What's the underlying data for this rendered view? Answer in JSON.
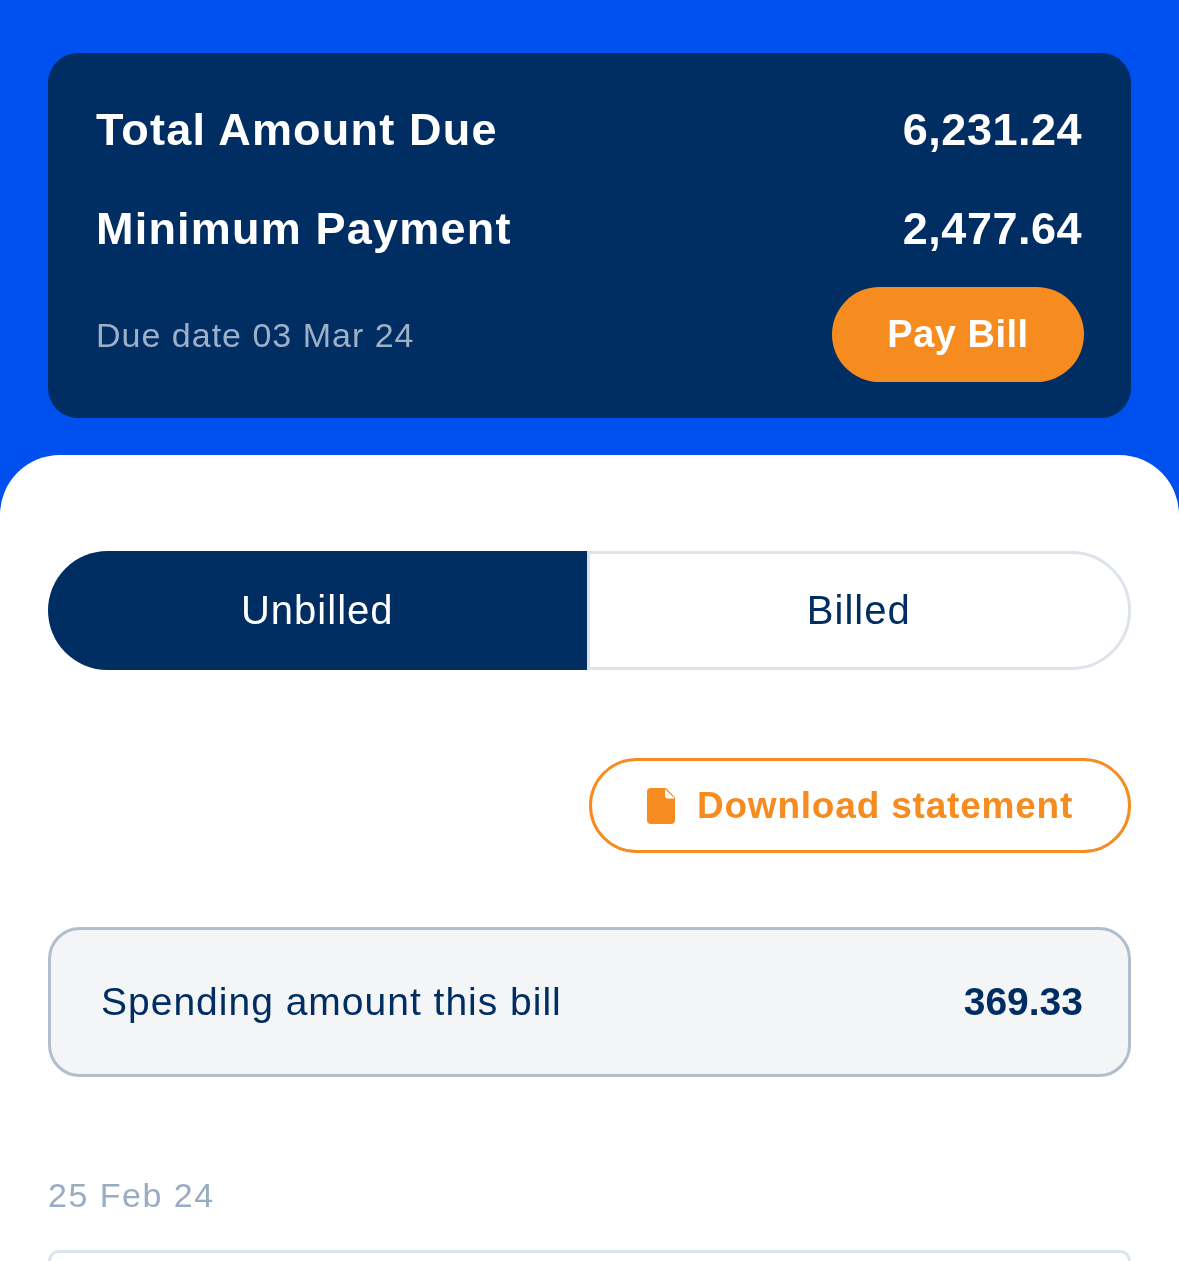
{
  "summary": {
    "rows": [
      {
        "label": "Total Amount Due",
        "value": "6,231.24"
      },
      {
        "label": "Minimum Payment",
        "value": "2,477.64"
      }
    ],
    "due_date": "Due date 03 Mar 24",
    "pay_button": "Pay Bill"
  },
  "tabs": [
    {
      "label": "Unbilled",
      "selected": true
    },
    {
      "label": "Billed",
      "selected": false
    }
  ],
  "download_button": "Download statement",
  "spending": {
    "label": "Spending amount this bill",
    "value": "369.33"
  },
  "transaction_groups": [
    {
      "date": "25 Feb 24"
    }
  ]
}
